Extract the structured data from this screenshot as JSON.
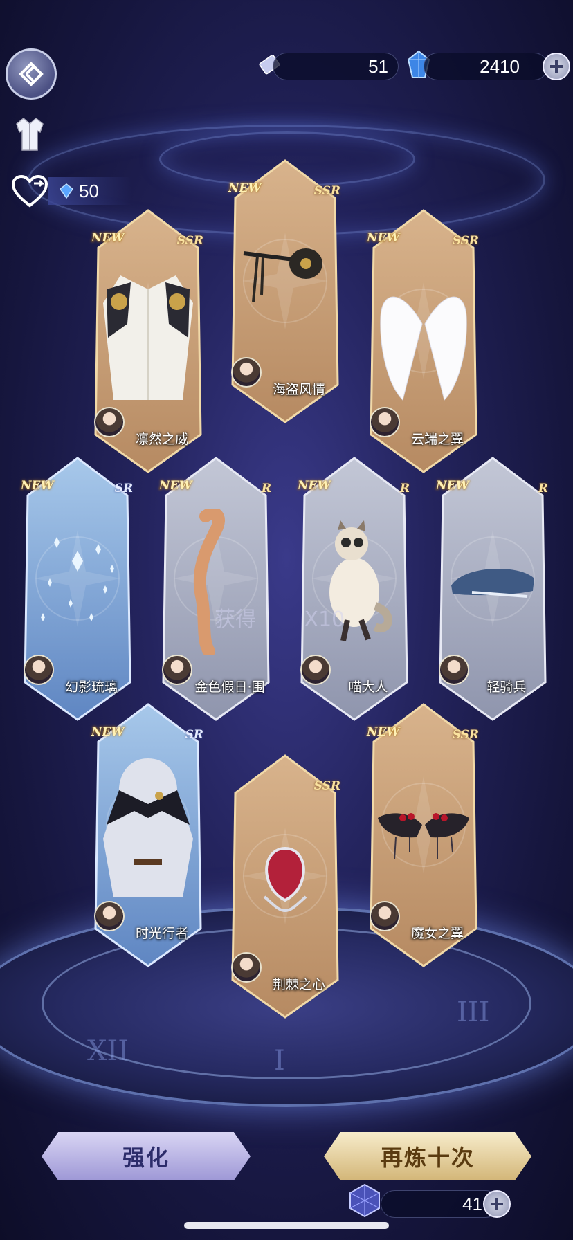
{
  "top_bar": {
    "tickets": "51",
    "diamonds": "2410"
  },
  "affinity": {
    "value": "50"
  },
  "cards": [
    {
      "new": "NEW",
      "rarity": "SSR",
      "name": "凛然之威",
      "theme": "gold"
    },
    {
      "new": "NEW",
      "rarity": "SSR",
      "name": "海盗风情",
      "theme": "gold"
    },
    {
      "new": "NEW",
      "rarity": "SSR",
      "name": "云端之翼",
      "theme": "gold"
    },
    {
      "new": "NEW",
      "rarity": "SR",
      "name": "幻影琉璃",
      "theme": "blue"
    },
    {
      "new": "NEW",
      "rarity": "R",
      "name": "金色假日·围",
      "theme": "silver"
    },
    {
      "new": "NEW",
      "rarity": "R",
      "name": "喵大人",
      "theme": "silver"
    },
    {
      "new": "NEW",
      "rarity": "R",
      "name": "轻骑兵",
      "theme": "silver"
    },
    {
      "new": "NEW",
      "rarity": "SR",
      "name": "时光行者",
      "theme": "blue"
    },
    {
      "new": "",
      "rarity": "SSR",
      "name": "荆棘之心",
      "theme": "gold"
    },
    {
      "new": "NEW",
      "rarity": "SSR",
      "name": "魔女之翼",
      "theme": "gold"
    }
  ],
  "obtain_text": "获得",
  "obtain_count": "X10",
  "buttons": {
    "enhance": "强化",
    "refine_ten": "再炼十次"
  },
  "refine_cost": "41",
  "colors": {
    "gold_card": "#c9a17a",
    "silver_card": "#aeb3c4",
    "blue_card": "#8ab0d8",
    "enhance_button": "#b7b2e3",
    "refine_button": "#e7d3a0"
  },
  "icons": [
    "back-icon",
    "outfit-icon",
    "heart-exchange-icon",
    "ticket-icon",
    "diamond-icon",
    "plus-icon",
    "crystal-cube-icon"
  ]
}
